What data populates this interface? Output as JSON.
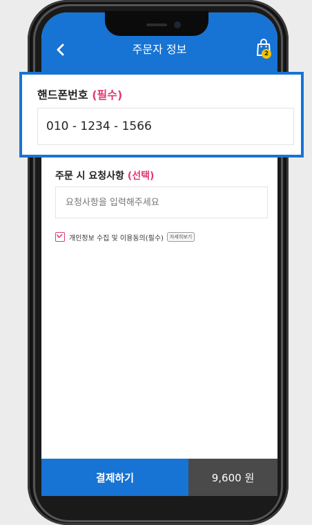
{
  "header": {
    "title": "주문자 정보",
    "cart_count": "2"
  },
  "phone_section": {
    "label": "핸드폰번호",
    "label_tag": "(필수)",
    "value": "010 - 1234 - 1566"
  },
  "request_section": {
    "label": "주문 시 요청사항",
    "label_tag": "(선택)",
    "placeholder": "요청사항을 입력해주세요"
  },
  "consent": {
    "text": "개인정보 수집 및 이용동의",
    "tag": "(필수)",
    "detail_button": "자세히보기",
    "checked": true
  },
  "footer": {
    "pay_label": "결제하기",
    "price": "9,600 원"
  },
  "colors": {
    "primary": "#1773d4",
    "accent": "#e23a6e",
    "badge": "#f5c400",
    "price_bg": "#4a4a4a"
  }
}
